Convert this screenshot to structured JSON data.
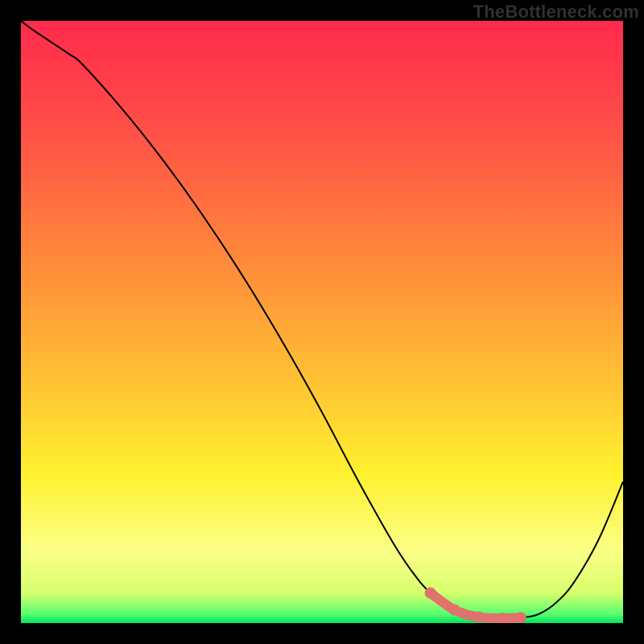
{
  "watermark": "TheBottleneck.com",
  "chart_data": {
    "type": "line",
    "title": "",
    "xlabel": "",
    "ylabel": "",
    "xlim": [
      0,
      1
    ],
    "ylim": [
      0,
      1
    ],
    "series": [
      {
        "name": "bottleneck-curve",
        "x": [
          0.0,
          0.02,
          0.05,
          0.08,
          0.1,
          0.15,
          0.2,
          0.25,
          0.3,
          0.35,
          0.4,
          0.45,
          0.5,
          0.55,
          0.58,
          0.62,
          0.65,
          0.68,
          0.72,
          0.76,
          0.8,
          0.83,
          0.86,
          0.89,
          0.92,
          0.96,
          1.0
        ],
        "y": [
          1.0,
          0.985,
          0.965,
          0.945,
          0.93,
          0.875,
          0.815,
          0.75,
          0.68,
          0.605,
          0.525,
          0.44,
          0.35,
          0.255,
          0.2,
          0.13,
          0.085,
          0.05,
          0.022,
          0.01,
          0.008,
          0.009,
          0.015,
          0.035,
          0.07,
          0.14,
          0.235
        ],
        "color": "#000000"
      }
    ],
    "highlight": {
      "name": "optimal-zone",
      "x": [
        0.68,
        0.72,
        0.76,
        0.8,
        0.83
      ],
      "y": [
        0.05,
        0.022,
        0.01,
        0.008,
        0.009
      ],
      "color": "#e0716c"
    },
    "gradient_stops": [
      {
        "offset": 0.0,
        "color": "#ff2a4c"
      },
      {
        "offset": 0.18,
        "color": "#ff4f47"
      },
      {
        "offset": 0.4,
        "color": "#ff8a3a"
      },
      {
        "offset": 0.6,
        "color": "#ffc234"
      },
      {
        "offset": 0.75,
        "color": "#fff12e"
      },
      {
        "offset": 0.88,
        "color": "#fbff86"
      },
      {
        "offset": 0.95,
        "color": "#d7ff6d"
      },
      {
        "offset": 0.985,
        "color": "#57ff6e"
      },
      {
        "offset": 1.0,
        "color": "#00e35a"
      }
    ]
  }
}
